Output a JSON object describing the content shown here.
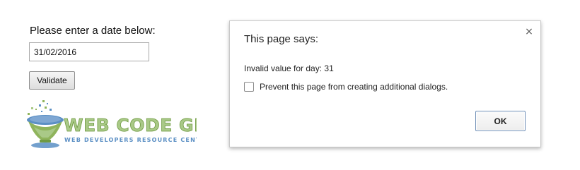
{
  "form": {
    "prompt": "Please enter a date below:",
    "date_value": "31/02/2016",
    "validate_label": "Validate"
  },
  "logo": {
    "name": "WEB CODE GEEKS",
    "tagline": "WEB DEVELOPERS RESOURCE CENTER",
    "colors": {
      "primary": "#8fb45c",
      "accent": "#5b8fc4"
    }
  },
  "dialog": {
    "title": "This page says:",
    "message": "Invalid value for day: 31",
    "prevent_label": "Prevent this page from creating additional dialogs.",
    "prevent_checked": false,
    "ok_label": "OK",
    "close_glyph": "×"
  }
}
